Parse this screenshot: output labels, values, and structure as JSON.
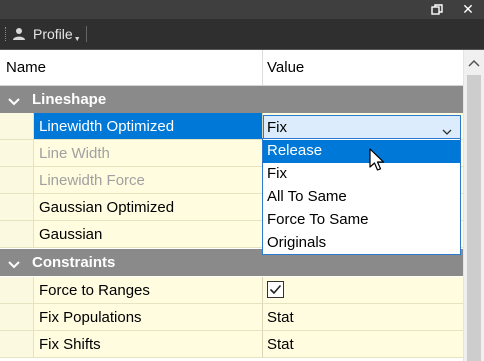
{
  "window": {
    "restore_icon": "restore-icon",
    "close_icon": "close-icon",
    "close_glyph": "✕"
  },
  "toolbar": {
    "profile_label": "Profile",
    "profile_icon": "person-icon"
  },
  "grid": {
    "columns": {
      "name": "Name",
      "value": "Value"
    },
    "categories": {
      "lineshape": "Lineshape",
      "constraints": "Constraints"
    },
    "lineshape_rows": [
      {
        "name": "Linewidth Optimized",
        "value": "Fix",
        "state": "selected"
      },
      {
        "name": "Line Width",
        "value": "",
        "state": "disabled"
      },
      {
        "name": "Linewidth Force",
        "value": "",
        "state": "disabled"
      },
      {
        "name": "Gaussian Optimized",
        "value": "",
        "state": "normal"
      },
      {
        "name": "Gaussian",
        "value": "",
        "state": "normal"
      }
    ],
    "constraints_rows": [
      {
        "name": "Force to Ranges",
        "value": "",
        "checked": true
      },
      {
        "name": "Fix Populations",
        "value": "Stat"
      },
      {
        "name": "Fix Shifts",
        "value": "Stat"
      }
    ]
  },
  "dropdown": {
    "options": [
      "Release",
      "Fix",
      "All To Same",
      "Force To Same",
      "Originals"
    ],
    "highlighted": "Release"
  },
  "colors": {
    "selection": "#0078d7",
    "category_bg": "#8a8a8a",
    "property_bg": "#fffce0"
  }
}
